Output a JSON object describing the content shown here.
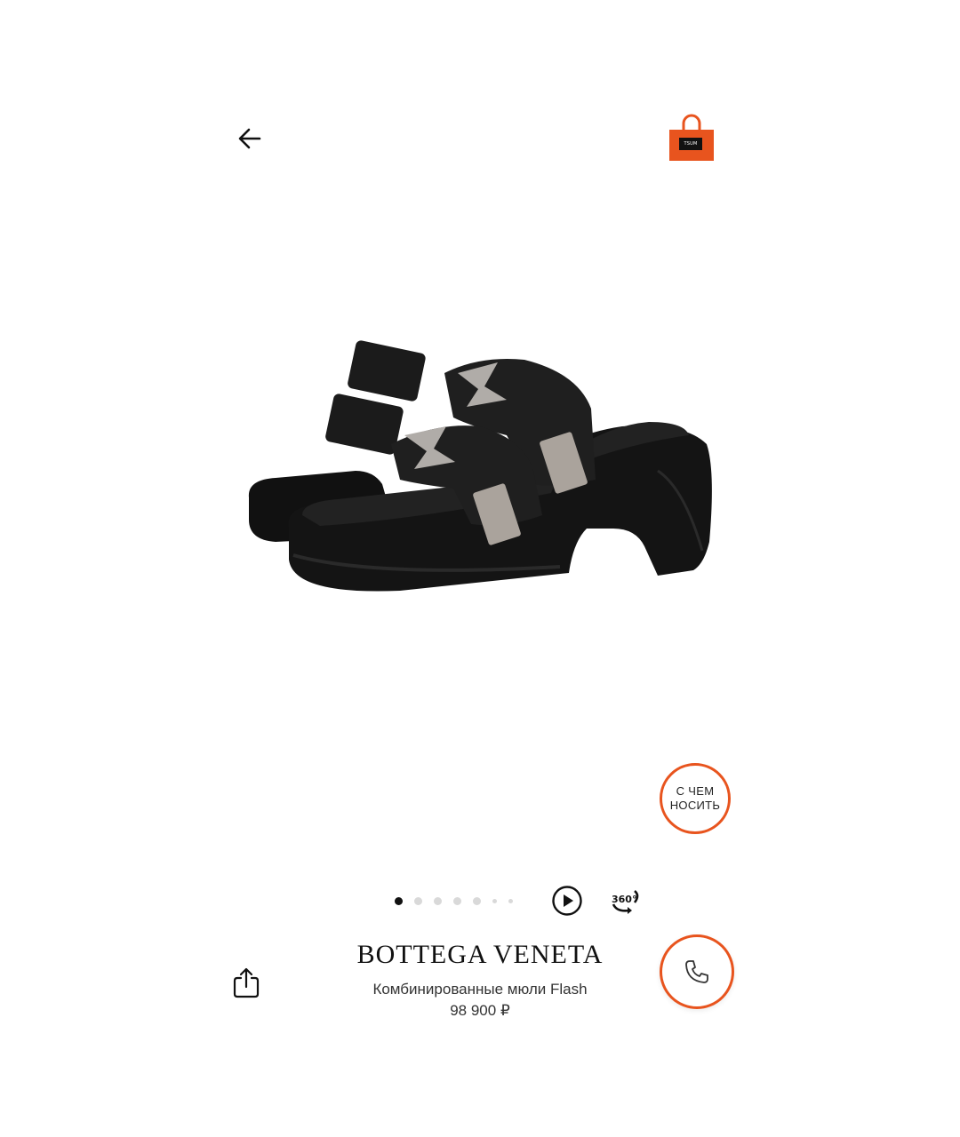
{
  "header": {
    "back_icon": "arrow-left-icon",
    "bag_icon": "shopping-bag-icon",
    "bag_logo_text": "TSUM",
    "accent": "#e8541e"
  },
  "gallery": {
    "total_images": 7,
    "active_index": 0,
    "play_icon": "play-icon",
    "spin_icon": "360-icon",
    "spin_label": "360°"
  },
  "wear_button": {
    "label": "С ЧЕМ НОСИТЬ"
  },
  "product": {
    "brand": "BOTTEGA VENETA",
    "name": "Комбинированные мюли Flash",
    "price": "98 900 ₽"
  },
  "actions": {
    "share_icon": "share-icon",
    "call_icon": "phone-icon"
  }
}
